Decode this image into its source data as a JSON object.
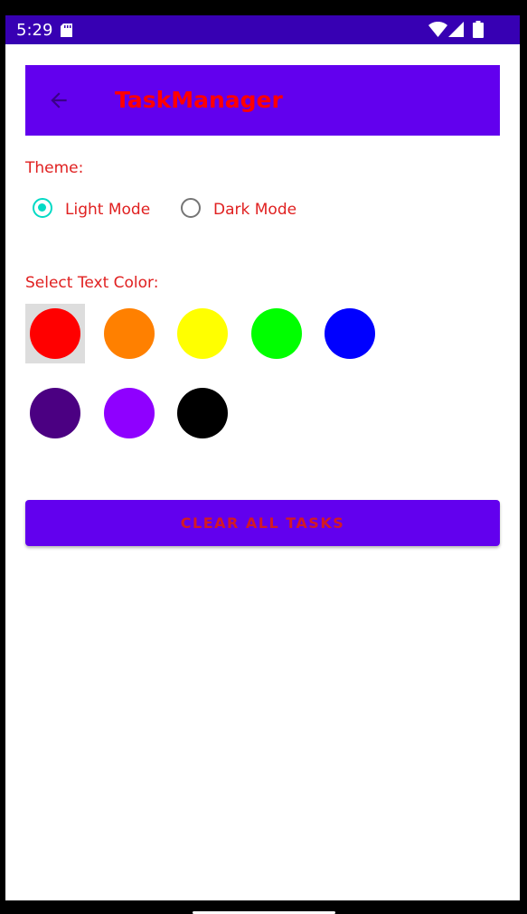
{
  "status_bar": {
    "time": "5:29",
    "icons": [
      "sd-card-icon",
      "wifi-icon",
      "signal-icon",
      "battery-icon"
    ]
  },
  "app_bar": {
    "title": "TaskManager",
    "back_icon": "arrow-back-icon"
  },
  "theme": {
    "label": "Theme:",
    "options": [
      {
        "label": "Light Mode",
        "checked": true
      },
      {
        "label": "Dark Mode",
        "checked": false
      }
    ]
  },
  "text_color": {
    "label": "Select Text Color:",
    "selected_index": 0,
    "colors": [
      {
        "name": "red",
        "hex": "#ff0000"
      },
      {
        "name": "orange",
        "hex": "#ff8000"
      },
      {
        "name": "yellow",
        "hex": "#ffff00"
      },
      {
        "name": "green",
        "hex": "#00ff00"
      },
      {
        "name": "blue",
        "hex": "#0000ff"
      },
      {
        "name": "indigo",
        "hex": "#4b0082"
      },
      {
        "name": "violet",
        "hex": "#8f00ff"
      },
      {
        "name": "black",
        "hex": "#000000"
      }
    ]
  },
  "clear_button": {
    "label": "CLEAR ALL TASKS"
  },
  "colors": {
    "status_bar": "#3700b3",
    "primary": "#6200ee",
    "accent": "#03dac5",
    "text": "#e02020"
  }
}
